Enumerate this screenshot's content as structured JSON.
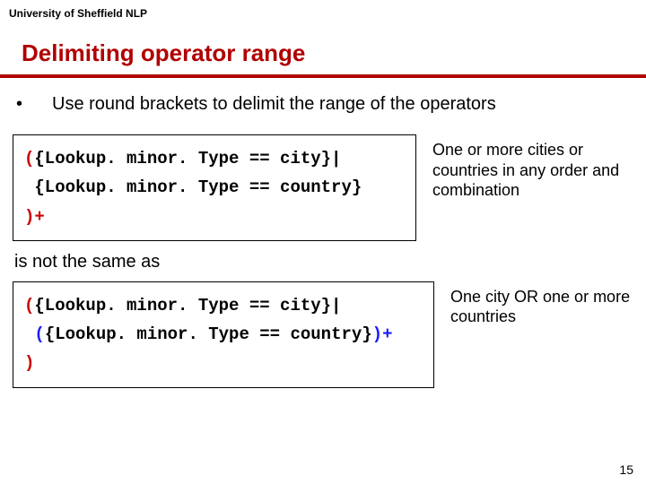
{
  "header": "University of Sheffield NLP",
  "title": "Delimiting operator range",
  "bullet": "•",
  "bullet_text": "Use round brackets to delimit the range of the operators",
  "code1": {
    "l1_open": "(",
    "l1_rest": "{Lookup. minor. Type == city}|",
    "l2": " {Lookup. minor. Type == country}",
    "l3": ")+"
  },
  "note1": "One or more cities or countries in any order and combination",
  "mid": "is not the same as",
  "code2": {
    "l1_open": "(",
    "l1_rest": "{Lookup. minor. Type == city}|",
    "l2_pre": " ",
    "l2_open": "(",
    "l2_mid": "{Lookup. minor. Type == country}",
    "l2_close": ")+",
    "l3": ")"
  },
  "note2": "One city OR one or more countries",
  "page": "15"
}
